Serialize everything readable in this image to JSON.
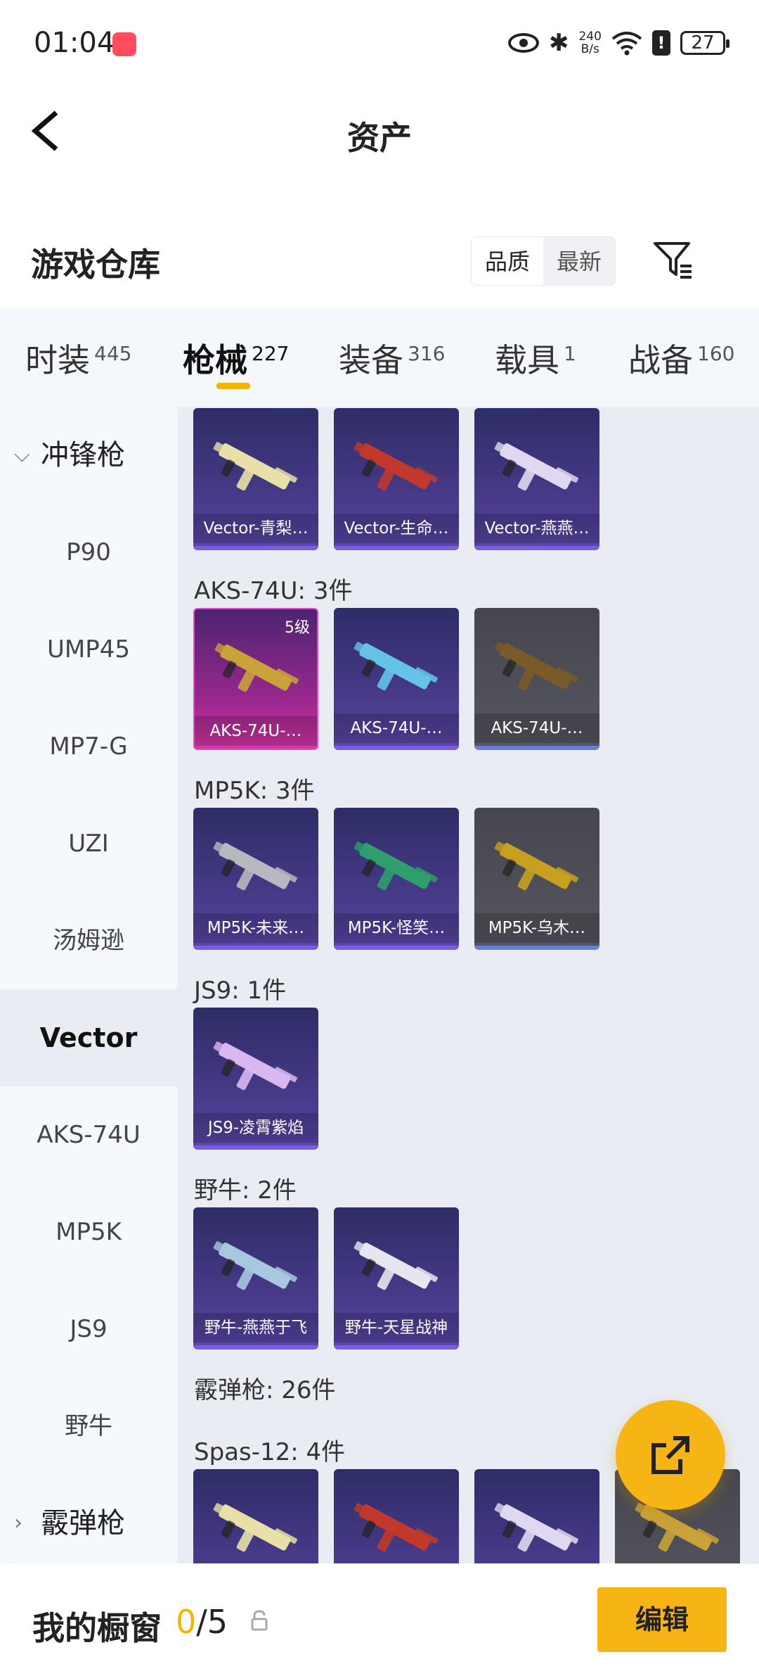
{
  "status_bar": {
    "time": "01:04",
    "network_speed_value": "240",
    "network_speed_unit": "B/s",
    "battery": "27"
  },
  "header": {
    "title": "资产",
    "back_icon": "back-arrow-icon"
  },
  "section": {
    "title": "游戏仓库",
    "sort_options": [
      "品质",
      "最新"
    ],
    "selected_sort": "品质",
    "filter_icon": "filter-icon"
  },
  "tabs": [
    {
      "label": "时装",
      "count": "445"
    },
    {
      "label": "枪械",
      "count": "227"
    },
    {
      "label": "装备",
      "count": "316"
    },
    {
      "label": "载具",
      "count": "1"
    },
    {
      "label": "战备",
      "count": "160"
    }
  ],
  "active_tab": "枪械",
  "sidebar": {
    "items": [
      {
        "label": "冲锋枪",
        "type": "group-expanded"
      },
      {
        "label": "P90"
      },
      {
        "label": "UMP45"
      },
      {
        "label": "MP7-G"
      },
      {
        "label": "UZI"
      },
      {
        "label": "汤姆逊"
      },
      {
        "label": "Vector",
        "selected": true
      },
      {
        "label": "AKS-74U"
      },
      {
        "label": "MP5K"
      },
      {
        "label": "JS9"
      },
      {
        "label": "野牛"
      },
      {
        "label": "霰弹枪",
        "type": "group-collapsed"
      }
    ]
  },
  "groups": [
    {
      "label": "",
      "items": [
        {
          "name": "Vector-青梨…",
          "tier": "purple"
        },
        {
          "name": "Vector-生命…",
          "tier": "purple"
        },
        {
          "name": "Vector-燕燕…",
          "tier": "purple"
        }
      ]
    },
    {
      "label": "AKS-74U: 3件",
      "items": [
        {
          "name": "AKS-74U-…",
          "tier": "pink",
          "level": "5级"
        },
        {
          "name": "AKS-74U-…",
          "tier": "purple"
        },
        {
          "name": "AKS-74U-…",
          "tier": "gray"
        }
      ]
    },
    {
      "label": "MP5K: 3件",
      "items": [
        {
          "name": "MP5K-未来…",
          "tier": "purple"
        },
        {
          "name": "MP5K-怪笑…",
          "tier": "purple"
        },
        {
          "name": "MP5K-乌木…",
          "tier": "gray"
        }
      ]
    },
    {
      "label": "JS9: 1件",
      "items": [
        {
          "name": "JS9-凌霄紫焰",
          "tier": "purple"
        }
      ]
    },
    {
      "label": "野牛: 2件",
      "items": [
        {
          "name": "野牛-燕燕于飞",
          "tier": "purple"
        },
        {
          "name": "野牛-天星战神",
          "tier": "purple"
        }
      ]
    },
    {
      "label": "霰弹枪: 26件",
      "items": []
    },
    {
      "label": "Spas-12: 4件",
      "items": [
        {
          "name": "",
          "tier": "purple"
        },
        {
          "name": "",
          "tier": "purple"
        },
        {
          "name": "",
          "tier": "purple"
        },
        {
          "name": "",
          "tier": "gray"
        }
      ]
    }
  ],
  "fab": {
    "icon": "share-icon"
  },
  "bottom_bar": {
    "label": "我的橱窗",
    "current": "0",
    "separator_total": "/5",
    "lock_icon": "lock-icon",
    "edit_label": "编辑"
  },
  "colors": {
    "accent": "#f7b515",
    "purple_tier": "#5b47a8",
    "pink_tier": "#d838a8",
    "gray_tier": "#55565f"
  }
}
